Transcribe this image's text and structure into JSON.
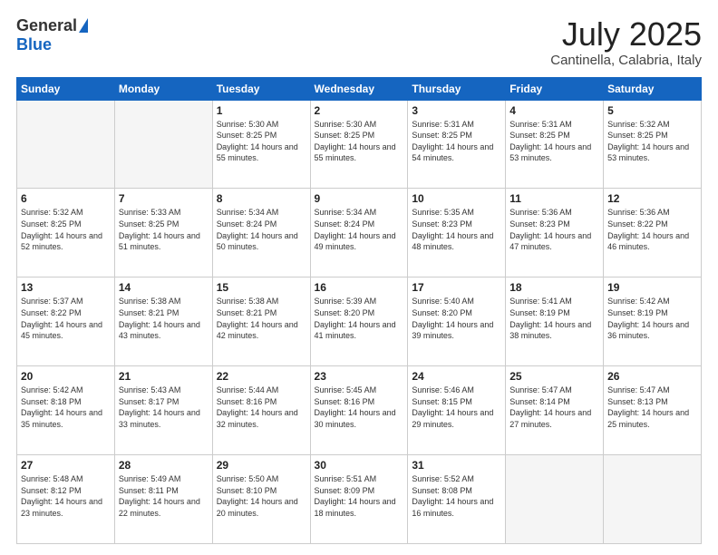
{
  "header": {
    "logo_general": "General",
    "logo_blue": "Blue",
    "month_title": "July 2025",
    "location": "Cantinella, Calabria, Italy"
  },
  "weekdays": [
    "Sunday",
    "Monday",
    "Tuesday",
    "Wednesday",
    "Thursday",
    "Friday",
    "Saturday"
  ],
  "weeks": [
    [
      {
        "day": "",
        "sunrise": "",
        "sunset": "",
        "daylight": ""
      },
      {
        "day": "",
        "sunrise": "",
        "sunset": "",
        "daylight": ""
      },
      {
        "day": "1",
        "sunrise": "Sunrise: 5:30 AM",
        "sunset": "Sunset: 8:25 PM",
        "daylight": "Daylight: 14 hours and 55 minutes."
      },
      {
        "day": "2",
        "sunrise": "Sunrise: 5:30 AM",
        "sunset": "Sunset: 8:25 PM",
        "daylight": "Daylight: 14 hours and 55 minutes."
      },
      {
        "day": "3",
        "sunrise": "Sunrise: 5:31 AM",
        "sunset": "Sunset: 8:25 PM",
        "daylight": "Daylight: 14 hours and 54 minutes."
      },
      {
        "day": "4",
        "sunrise": "Sunrise: 5:31 AM",
        "sunset": "Sunset: 8:25 PM",
        "daylight": "Daylight: 14 hours and 53 minutes."
      },
      {
        "day": "5",
        "sunrise": "Sunrise: 5:32 AM",
        "sunset": "Sunset: 8:25 PM",
        "daylight": "Daylight: 14 hours and 53 minutes."
      }
    ],
    [
      {
        "day": "6",
        "sunrise": "Sunrise: 5:32 AM",
        "sunset": "Sunset: 8:25 PM",
        "daylight": "Daylight: 14 hours and 52 minutes."
      },
      {
        "day": "7",
        "sunrise": "Sunrise: 5:33 AM",
        "sunset": "Sunset: 8:25 PM",
        "daylight": "Daylight: 14 hours and 51 minutes."
      },
      {
        "day": "8",
        "sunrise": "Sunrise: 5:34 AM",
        "sunset": "Sunset: 8:24 PM",
        "daylight": "Daylight: 14 hours and 50 minutes."
      },
      {
        "day": "9",
        "sunrise": "Sunrise: 5:34 AM",
        "sunset": "Sunset: 8:24 PM",
        "daylight": "Daylight: 14 hours and 49 minutes."
      },
      {
        "day": "10",
        "sunrise": "Sunrise: 5:35 AM",
        "sunset": "Sunset: 8:23 PM",
        "daylight": "Daylight: 14 hours and 48 minutes."
      },
      {
        "day": "11",
        "sunrise": "Sunrise: 5:36 AM",
        "sunset": "Sunset: 8:23 PM",
        "daylight": "Daylight: 14 hours and 47 minutes."
      },
      {
        "day": "12",
        "sunrise": "Sunrise: 5:36 AM",
        "sunset": "Sunset: 8:22 PM",
        "daylight": "Daylight: 14 hours and 46 minutes."
      }
    ],
    [
      {
        "day": "13",
        "sunrise": "Sunrise: 5:37 AM",
        "sunset": "Sunset: 8:22 PM",
        "daylight": "Daylight: 14 hours and 45 minutes."
      },
      {
        "day": "14",
        "sunrise": "Sunrise: 5:38 AM",
        "sunset": "Sunset: 8:21 PM",
        "daylight": "Daylight: 14 hours and 43 minutes."
      },
      {
        "day": "15",
        "sunrise": "Sunrise: 5:38 AM",
        "sunset": "Sunset: 8:21 PM",
        "daylight": "Daylight: 14 hours and 42 minutes."
      },
      {
        "day": "16",
        "sunrise": "Sunrise: 5:39 AM",
        "sunset": "Sunset: 8:20 PM",
        "daylight": "Daylight: 14 hours and 41 minutes."
      },
      {
        "day": "17",
        "sunrise": "Sunrise: 5:40 AM",
        "sunset": "Sunset: 8:20 PM",
        "daylight": "Daylight: 14 hours and 39 minutes."
      },
      {
        "day": "18",
        "sunrise": "Sunrise: 5:41 AM",
        "sunset": "Sunset: 8:19 PM",
        "daylight": "Daylight: 14 hours and 38 minutes."
      },
      {
        "day": "19",
        "sunrise": "Sunrise: 5:42 AM",
        "sunset": "Sunset: 8:19 PM",
        "daylight": "Daylight: 14 hours and 36 minutes."
      }
    ],
    [
      {
        "day": "20",
        "sunrise": "Sunrise: 5:42 AM",
        "sunset": "Sunset: 8:18 PM",
        "daylight": "Daylight: 14 hours and 35 minutes."
      },
      {
        "day": "21",
        "sunrise": "Sunrise: 5:43 AM",
        "sunset": "Sunset: 8:17 PM",
        "daylight": "Daylight: 14 hours and 33 minutes."
      },
      {
        "day": "22",
        "sunrise": "Sunrise: 5:44 AM",
        "sunset": "Sunset: 8:16 PM",
        "daylight": "Daylight: 14 hours and 32 minutes."
      },
      {
        "day": "23",
        "sunrise": "Sunrise: 5:45 AM",
        "sunset": "Sunset: 8:16 PM",
        "daylight": "Daylight: 14 hours and 30 minutes."
      },
      {
        "day": "24",
        "sunrise": "Sunrise: 5:46 AM",
        "sunset": "Sunset: 8:15 PM",
        "daylight": "Daylight: 14 hours and 29 minutes."
      },
      {
        "day": "25",
        "sunrise": "Sunrise: 5:47 AM",
        "sunset": "Sunset: 8:14 PM",
        "daylight": "Daylight: 14 hours and 27 minutes."
      },
      {
        "day": "26",
        "sunrise": "Sunrise: 5:47 AM",
        "sunset": "Sunset: 8:13 PM",
        "daylight": "Daylight: 14 hours and 25 minutes."
      }
    ],
    [
      {
        "day": "27",
        "sunrise": "Sunrise: 5:48 AM",
        "sunset": "Sunset: 8:12 PM",
        "daylight": "Daylight: 14 hours and 23 minutes."
      },
      {
        "day": "28",
        "sunrise": "Sunrise: 5:49 AM",
        "sunset": "Sunset: 8:11 PM",
        "daylight": "Daylight: 14 hours and 22 minutes."
      },
      {
        "day": "29",
        "sunrise": "Sunrise: 5:50 AM",
        "sunset": "Sunset: 8:10 PM",
        "daylight": "Daylight: 14 hours and 20 minutes."
      },
      {
        "day": "30",
        "sunrise": "Sunrise: 5:51 AM",
        "sunset": "Sunset: 8:09 PM",
        "daylight": "Daylight: 14 hours and 18 minutes."
      },
      {
        "day": "31",
        "sunrise": "Sunrise: 5:52 AM",
        "sunset": "Sunset: 8:08 PM",
        "daylight": "Daylight: 14 hours and 16 minutes."
      },
      {
        "day": "",
        "sunrise": "",
        "sunset": "",
        "daylight": ""
      },
      {
        "day": "",
        "sunrise": "",
        "sunset": "",
        "daylight": ""
      }
    ]
  ]
}
